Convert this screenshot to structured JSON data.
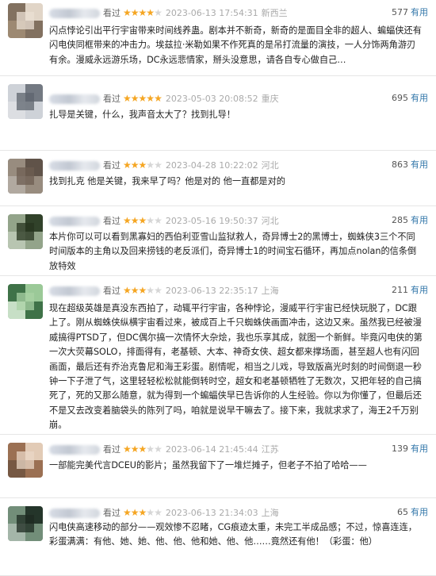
{
  "useful_label": "有用",
  "watched_label": "看过",
  "colors": {
    "star": "#f5a623",
    "link": "#3377aa"
  },
  "comments": [
    {
      "stars": 4,
      "time": "2023-06-13 17:54:31",
      "location": "新西兰",
      "votes": "577",
      "text": "闪点悖论引出平行宇宙带来时间线养蛊。剧本并不新奇，新奇的是面目全非的超人、蝙蝠侠还有闪电侠同框带来的冲击力。埃兹拉·米勒如果不作死真的是吊打流量的演技，一人分饰两角游刃有余。漫威永远游乐场，DC永远悲情家，掰头没意思，请各自专心做自己…"
    },
    {
      "stars": 5,
      "time": "2023-05-03 20:08:52",
      "location": "重庆",
      "votes": "695",
      "text": "扎导是关键，什么，我声音太大了？找到扎导！"
    },
    {
      "stars": 3,
      "time": "2023-04-28 10:22:02",
      "location": "河北",
      "votes": "863",
      "text": "找到扎克 他是关键，我来早了吗？他是对的 他一直都是对的"
    },
    {
      "stars": 3,
      "time": "2023-05-16 19:50:37",
      "location": "河北",
      "votes": "285",
      "text": "本片你可以可以看到黑寡妇的西伯利亚雪山监狱救人，奇异博士2的黑博士，蜘蛛侠3三个不同时间版本的主角以及回来捞钱的老反派们，奇异博士1的时间宝石循环，再加点nolan的信条倒放特效"
    },
    {
      "stars": 3,
      "time": "2023-06-13 22:35:17",
      "location": "上海",
      "votes": "211",
      "text": "现在超级英雄是真没东西拍了，动辄平行宇宙，各种悖论，漫威平行宇宙已经快玩脱了，DC跟上了。刚从蜘蛛侠纵横宇宙看过来，被成百上千只蜘蛛侠画面冲击，这边又来。虽然我已经被漫威搞得PTSD了，但DC偶尔搞一次情怀大杂烩，我也乐享其成，就图一个新鲜。毕竟闪电侠的第一次大荧幕SOLO，排面得有，老基顿、大本、神奇女侠、超女都来撑场面，甚至超人也有闪回画面，最后还有乔治克鲁尼和海王彩蛋。剧情呢，相当之儿戏，导致版高光时刻的时间倒退一秒钟一下子泄了气，这里轻轻松松就能倒转时空，超女和老基顿牺牲了无数次，又把年轻的自己搞死了，死的又那么随意，就为得到一个蝙蝠侠早已告诉你的人生经验。你以为你懂了，但最后还不是又去改变着脑袋头的陈列了吗，咱就是说早干嘛去了。接下来，我就求求了，海王2千万别崩。"
    },
    {
      "stars": 3,
      "time": "2023-06-14 21:45:44",
      "location": "江苏",
      "votes": "139",
      "text": "一部能完美代言DCEU的影片；虽然我留下了一堆烂摊子，但老子不拍了哈哈——"
    },
    {
      "stars": 3,
      "time": "2023-06-13 21:34:03",
      "location": "上海",
      "votes": "65",
      "text": "闪电侠高速移动的部分——观效惨不忍睹，CG痕迹太重，未完工半成品感；不过，惊喜连连，彩蛋满满：有他、她、她、他、他、他和她、他、他……竟然还有他！（彩蛋：他）"
    }
  ]
}
